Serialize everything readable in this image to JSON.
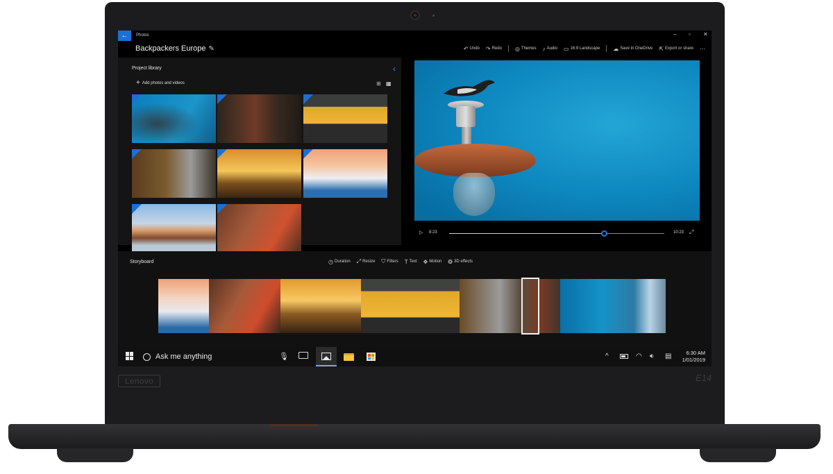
{
  "device": {
    "brand": "Lenovo",
    "model": "E14"
  },
  "window": {
    "app_name": "Photos",
    "back_icon": "arrow-left-icon",
    "controls": {
      "minimize": "‒",
      "maximize": "▫",
      "close": "✕"
    }
  },
  "header": {
    "project_title": "Backpackers Europe",
    "toolbar": [
      {
        "icon": "undo-icon",
        "glyph": "↶",
        "label": "Undo"
      },
      {
        "icon": "redo-icon",
        "glyph": "↷",
        "label": "Redo"
      },
      {
        "icon": "themes-icon",
        "glyph": "◎",
        "label": "Themes"
      },
      {
        "icon": "audio-icon",
        "glyph": "♪",
        "label": "Audio"
      },
      {
        "icon": "aspect-ratio-icon",
        "glyph": "▭",
        "label": "16:9 Landscape"
      },
      {
        "icon": "cloud-icon",
        "glyph": "☁",
        "label": "Save in OneDrive"
      },
      {
        "icon": "export-icon",
        "glyph": "⇱",
        "label": "Export or share"
      },
      {
        "icon": "more-icon",
        "glyph": "⋯",
        "label": ""
      }
    ]
  },
  "library": {
    "title": "Project library",
    "add_label": "Add photos and videos",
    "thumbnails": [
      "bird-on-lamp",
      "brick-house",
      "yellow-van",
      "hiker-overlook",
      "sunset-hikers",
      "santorini-village",
      "waterfront-houses",
      "hiker-with-hat"
    ]
  },
  "player": {
    "current_time": "8:23",
    "end_time": "10:23",
    "progress": 0.72
  },
  "storyboard": {
    "title": "Storyboard",
    "tools": [
      {
        "icon": "duration-icon",
        "glyph": "◷",
        "label": "Duration"
      },
      {
        "icon": "resize-icon",
        "glyph": "⤢",
        "label": "Resize"
      },
      {
        "icon": "filters-icon",
        "glyph": "⛉",
        "label": "Filters"
      },
      {
        "icon": "text-icon",
        "glyph": "T",
        "label": "Text"
      },
      {
        "icon": "motion-icon",
        "glyph": "✥",
        "label": "Motion"
      },
      {
        "icon": "3d-effects-icon",
        "glyph": "❂",
        "label": "3D effects"
      }
    ]
  },
  "taskbar": {
    "search_placeholder": "Ask me anything",
    "time": "6:30 AM",
    "date": "1/01/2019"
  }
}
